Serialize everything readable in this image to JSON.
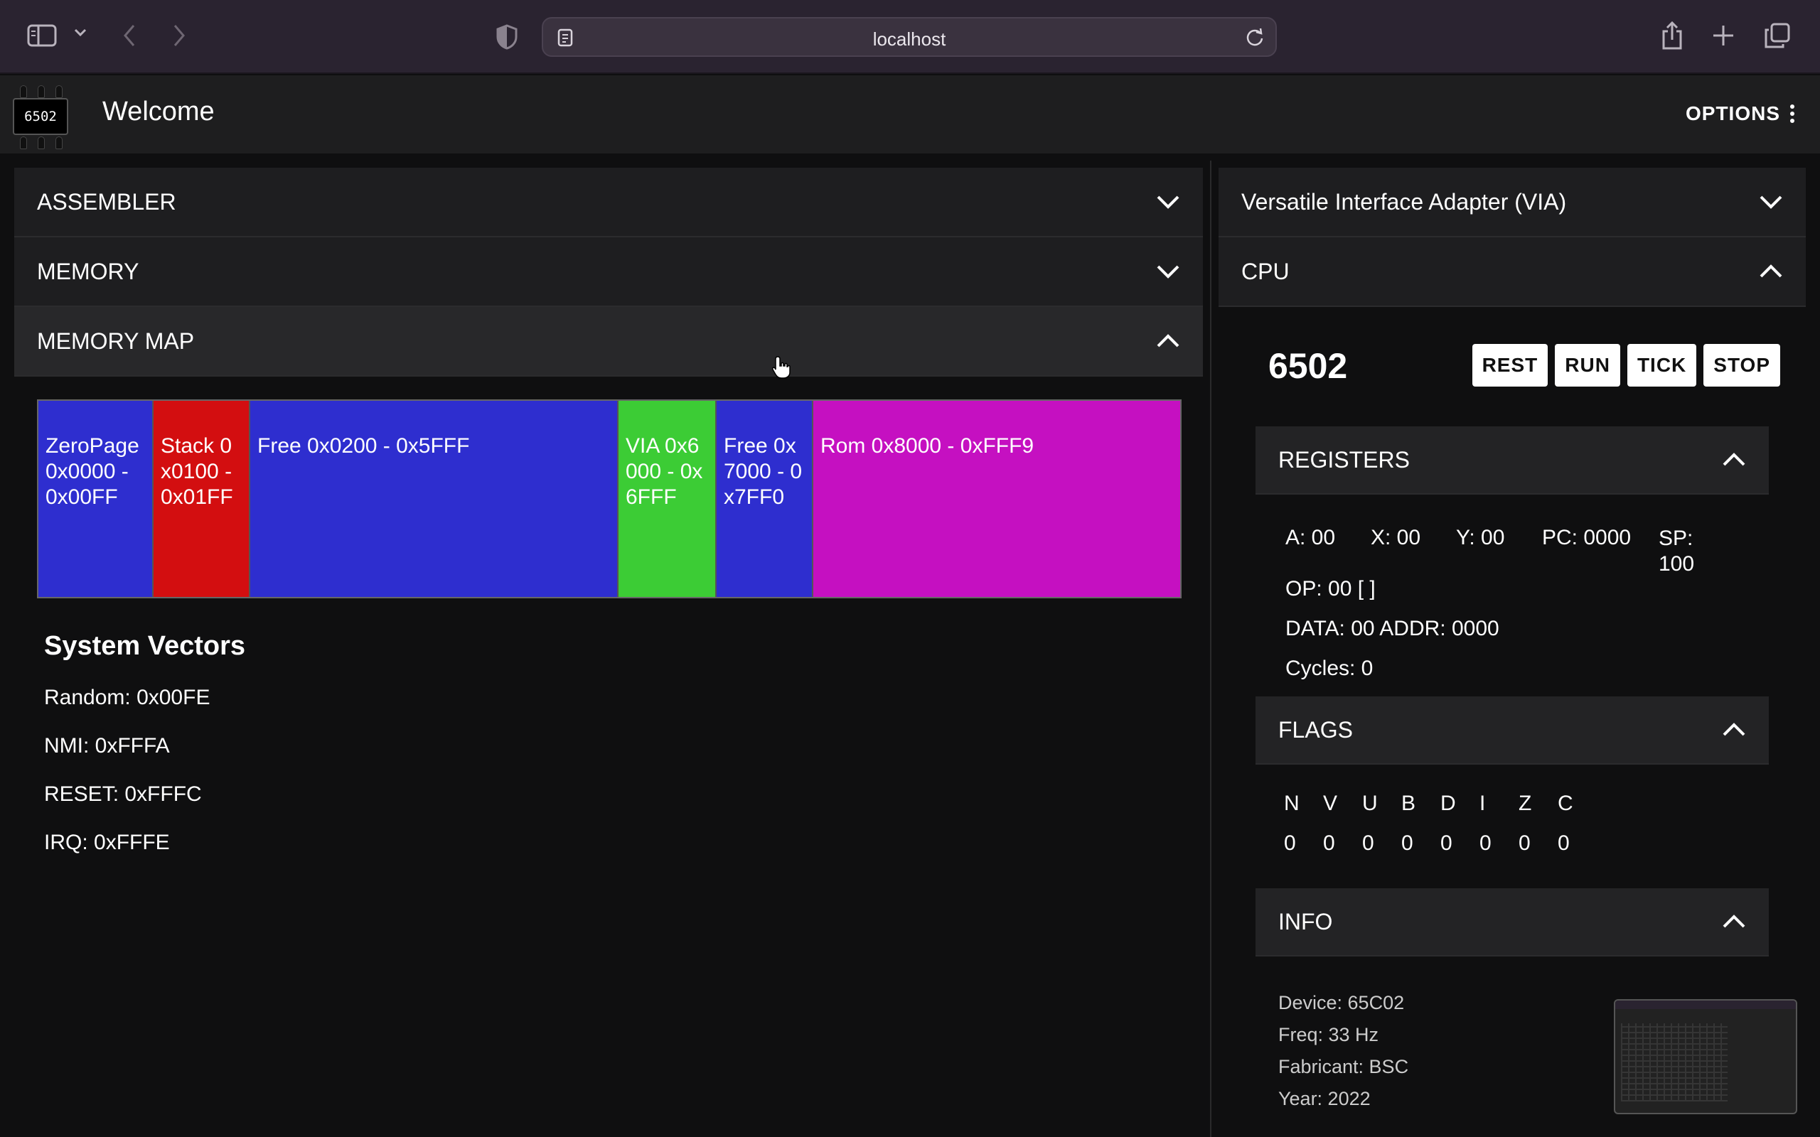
{
  "browser": {
    "url": "localhost"
  },
  "app": {
    "logo_text": "6502",
    "title": "Welcome",
    "options_label": "OPTIONS"
  },
  "left_panels": {
    "assembler": "ASSEMBLER",
    "memory": "MEMORY",
    "memory_map": "MEMORY MAP"
  },
  "memory_map": {
    "segments": [
      {
        "label": "ZeroPage 0x0000 - 0x00FF",
        "color": "#2e2ecf"
      },
      {
        "label": "Stack 0x0100 - 0x01FF",
        "color": "#d30e10"
      },
      {
        "label": "Free 0x0200 - 0x5FFF",
        "color": "#2e2ecf"
      },
      {
        "label": "VIA 0x6000 - 0x6FFF",
        "color": "#3ccc35"
      },
      {
        "label": "Free 0x7000 - 0x7FF0",
        "color": "#2e2ecf"
      },
      {
        "label": "Rom 0x8000 - 0xFFF9",
        "color": "#c510c1"
      }
    ]
  },
  "system_vectors": {
    "title": "System Vectors",
    "items": [
      "Random: 0x00FE",
      "NMI: 0xFFFA",
      "RESET: 0xFFFC",
      "IRQ: 0xFFFE"
    ]
  },
  "right_panels": {
    "via": "Versatile Interface Adapter (VIA)",
    "cpu": "CPU"
  },
  "cpu": {
    "name": "6502",
    "buttons": [
      "REST",
      "RUN",
      "TICK",
      "STOP"
    ],
    "registers_title": "REGISTERS",
    "registers": {
      "a": "A: 00",
      "x": "X: 00",
      "y": "Y: 00",
      "pc": "PC: 0000",
      "sp": "SP: 100",
      "op": "OP: 00 [ ]",
      "data_addr": "DATA: 00 ADDR: 0000",
      "cycles": "Cycles: 0"
    },
    "flags_title": "FLAGS",
    "flags": {
      "names": [
        "N",
        "V",
        "U",
        "B",
        "D",
        "I",
        "Z",
        "C"
      ],
      "values": [
        "0",
        "0",
        "0",
        "0",
        "0",
        "0",
        "0",
        "0"
      ]
    },
    "info_title": "INFO",
    "info": {
      "device": "Device: 65C02",
      "freq": "Freq: 33 Hz",
      "fabricant": "Fabricant: BSC",
      "year": "Year: 2022"
    }
  }
}
